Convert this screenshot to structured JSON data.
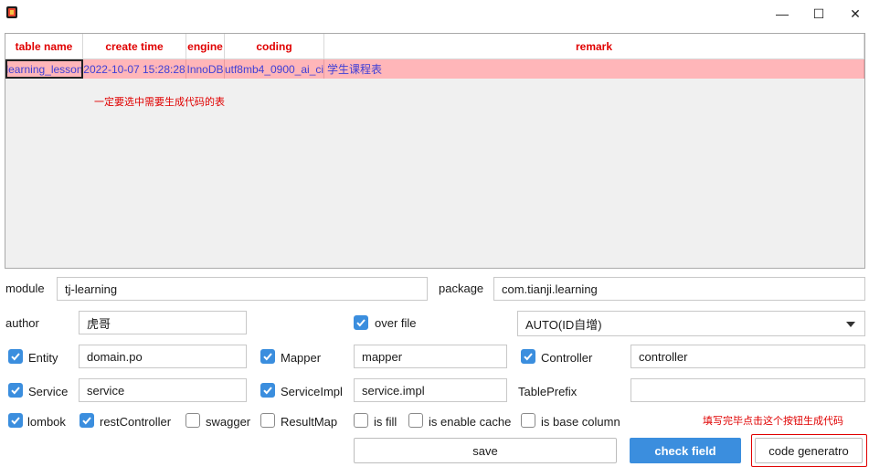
{
  "window": {
    "minimize_glyph": "—",
    "maximize_glyph": "☐",
    "close_glyph": "✕"
  },
  "table": {
    "columns": [
      "table name",
      "create time",
      "engine",
      "coding",
      "remark"
    ],
    "rows": [
      [
        "learning_lesson",
        "2022-10-07 15:28:28",
        "InnoDB",
        "utf8mb4_0900_ai_ci",
        "学生课程表"
      ]
    ],
    "hint": "一定要选中需要生成代码的表"
  },
  "form": {
    "module_label": "module",
    "module_value": "tj-learning",
    "package_label": "package",
    "package_value": "com.tianji.learning",
    "author_label": "author",
    "author_value": "虎哥",
    "over_file_label": "over file",
    "over_file_checked": true,
    "id_type_value": "AUTO(ID自增)",
    "entity_label": "Entity",
    "entity_checked": true,
    "entity_value": "domain.po",
    "mapper_label": "Mapper",
    "mapper_checked": true,
    "mapper_value": "mapper",
    "controller_label": "Controller",
    "controller_checked": true,
    "controller_value": "controller",
    "service_label": "Service",
    "service_checked": true,
    "service_value": "service",
    "serviceimpl_label": "ServiceImpl",
    "serviceimpl_checked": true,
    "serviceimpl_value": "service.impl",
    "table_prefix_label": "TablePrefix",
    "table_prefix_value": "",
    "lombok_label": "lombok",
    "lombok_checked": true,
    "restcontroller_label": "restController",
    "restcontroller_checked": true,
    "swagger_label": "swagger",
    "swagger_checked": false,
    "resultmap_label": "ResultMap",
    "resultmap_checked": false,
    "isfill_label": "is fill",
    "isfill_checked": false,
    "enable_cache_label": "is enable cache",
    "enable_cache_checked": false,
    "base_column_label": "is base column",
    "base_column_checked": false
  },
  "buttons": {
    "save": "save",
    "check_field": "check field",
    "code_generator": "code generatro",
    "generate_hint": "填写完毕点击这个按钮生成代码"
  },
  "colors": {
    "accent": "#3b8ede",
    "selected_row": "#ffb6b9",
    "header_text": "#e00000",
    "row_text": "#3f3fd6",
    "hint_text": "#e00000"
  }
}
